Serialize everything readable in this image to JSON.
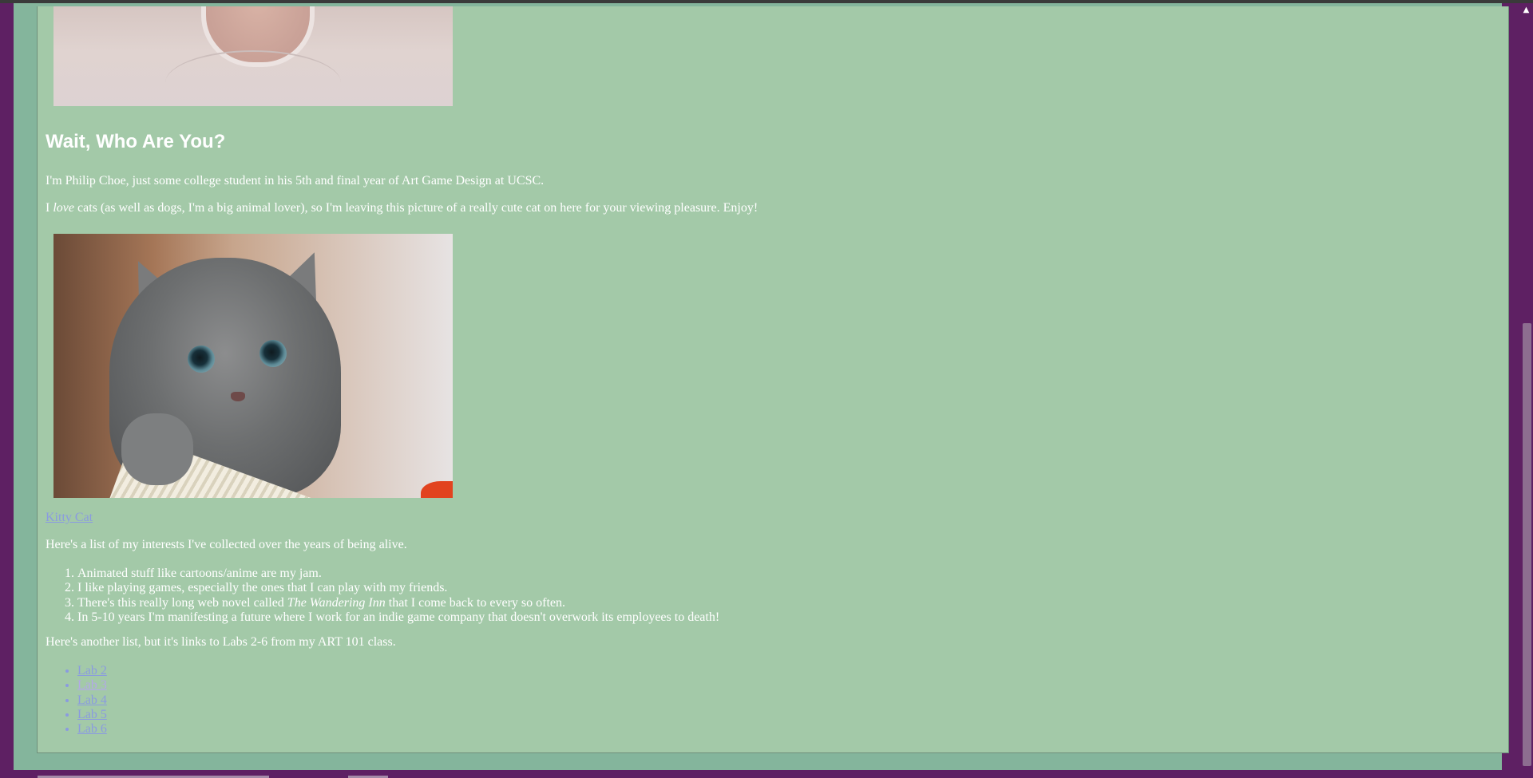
{
  "about": {
    "heading": "Wait, Who Are You?",
    "intro": "I'm Philip Choe, just some college student in his 5th and final year of Art Game Design at UCSC.",
    "cats_pre": "I ",
    "cats_em": "love",
    "cats_post": " cats (as well as dogs, I'm a big animal lover), so I'm leaving this picture of a really cute cat on here for your viewing pleasure. Enjoy!"
  },
  "kitten_link": "Kitty Cat",
  "interests": {
    "intro": "Here's a list of my interests I've collected over the years of being alive.",
    "items": [
      "Animated stuff like cartoons/anime are my jam.",
      "I like playing games, especially the ones that I can play with my friends.",
      "that I come back to every so often.",
      "In 5-10 years I'm manifesting a future where I work for an indie game company that doesn't overwork its employees to death!"
    ],
    "item3_pre": "There's this really long web novel called ",
    "item3_em": "The Wandering Inn"
  },
  "labs": {
    "intro": "Here's another list, but it's links to Labs 2-6 from my ART 101 class.",
    "links": [
      "Lab 2",
      "Lab 3",
      "Lab 4",
      "Lab 5",
      "Lab 6"
    ]
  },
  "scrollbar": {
    "up_arrow": "▲"
  },
  "colors": {
    "page_bg": "#5e2063",
    "content_bg": "#a3c9a8",
    "frame": "#84b59c",
    "link": "#8a9be0",
    "visited_link": "#b3a8e8"
  }
}
